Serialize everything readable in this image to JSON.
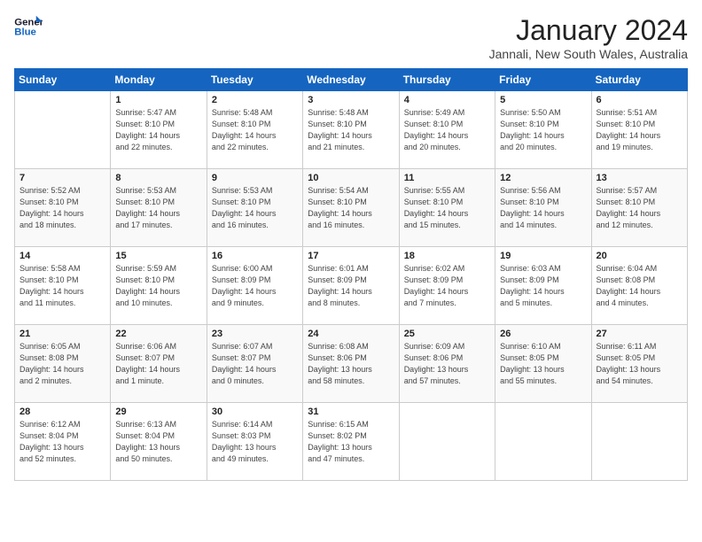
{
  "header": {
    "logo_line1": "General",
    "logo_line2": "Blue",
    "month_title": "January 2024",
    "location": "Jannali, New South Wales, Australia"
  },
  "weekdays": [
    "Sunday",
    "Monday",
    "Tuesday",
    "Wednesday",
    "Thursday",
    "Friday",
    "Saturday"
  ],
  "weeks": [
    [
      {
        "day": "",
        "info": ""
      },
      {
        "day": "1",
        "info": "Sunrise: 5:47 AM\nSunset: 8:10 PM\nDaylight: 14 hours\nand 22 minutes."
      },
      {
        "day": "2",
        "info": "Sunrise: 5:48 AM\nSunset: 8:10 PM\nDaylight: 14 hours\nand 22 minutes."
      },
      {
        "day": "3",
        "info": "Sunrise: 5:48 AM\nSunset: 8:10 PM\nDaylight: 14 hours\nand 21 minutes."
      },
      {
        "day": "4",
        "info": "Sunrise: 5:49 AM\nSunset: 8:10 PM\nDaylight: 14 hours\nand 20 minutes."
      },
      {
        "day": "5",
        "info": "Sunrise: 5:50 AM\nSunset: 8:10 PM\nDaylight: 14 hours\nand 20 minutes."
      },
      {
        "day": "6",
        "info": "Sunrise: 5:51 AM\nSunset: 8:10 PM\nDaylight: 14 hours\nand 19 minutes."
      }
    ],
    [
      {
        "day": "7",
        "info": "Sunrise: 5:52 AM\nSunset: 8:10 PM\nDaylight: 14 hours\nand 18 minutes."
      },
      {
        "day": "8",
        "info": "Sunrise: 5:53 AM\nSunset: 8:10 PM\nDaylight: 14 hours\nand 17 minutes."
      },
      {
        "day": "9",
        "info": "Sunrise: 5:53 AM\nSunset: 8:10 PM\nDaylight: 14 hours\nand 16 minutes."
      },
      {
        "day": "10",
        "info": "Sunrise: 5:54 AM\nSunset: 8:10 PM\nDaylight: 14 hours\nand 16 minutes."
      },
      {
        "day": "11",
        "info": "Sunrise: 5:55 AM\nSunset: 8:10 PM\nDaylight: 14 hours\nand 15 minutes."
      },
      {
        "day": "12",
        "info": "Sunrise: 5:56 AM\nSunset: 8:10 PM\nDaylight: 14 hours\nand 14 minutes."
      },
      {
        "day": "13",
        "info": "Sunrise: 5:57 AM\nSunset: 8:10 PM\nDaylight: 14 hours\nand 12 minutes."
      }
    ],
    [
      {
        "day": "14",
        "info": "Sunrise: 5:58 AM\nSunset: 8:10 PM\nDaylight: 14 hours\nand 11 minutes."
      },
      {
        "day": "15",
        "info": "Sunrise: 5:59 AM\nSunset: 8:10 PM\nDaylight: 14 hours\nand 10 minutes."
      },
      {
        "day": "16",
        "info": "Sunrise: 6:00 AM\nSunset: 8:09 PM\nDaylight: 14 hours\nand 9 minutes."
      },
      {
        "day": "17",
        "info": "Sunrise: 6:01 AM\nSunset: 8:09 PM\nDaylight: 14 hours\nand 8 minutes."
      },
      {
        "day": "18",
        "info": "Sunrise: 6:02 AM\nSunset: 8:09 PM\nDaylight: 14 hours\nand 7 minutes."
      },
      {
        "day": "19",
        "info": "Sunrise: 6:03 AM\nSunset: 8:09 PM\nDaylight: 14 hours\nand 5 minutes."
      },
      {
        "day": "20",
        "info": "Sunrise: 6:04 AM\nSunset: 8:08 PM\nDaylight: 14 hours\nand 4 minutes."
      }
    ],
    [
      {
        "day": "21",
        "info": "Sunrise: 6:05 AM\nSunset: 8:08 PM\nDaylight: 14 hours\nand 2 minutes."
      },
      {
        "day": "22",
        "info": "Sunrise: 6:06 AM\nSunset: 8:07 PM\nDaylight: 14 hours\nand 1 minute."
      },
      {
        "day": "23",
        "info": "Sunrise: 6:07 AM\nSunset: 8:07 PM\nDaylight: 14 hours\nand 0 minutes."
      },
      {
        "day": "24",
        "info": "Sunrise: 6:08 AM\nSunset: 8:06 PM\nDaylight: 13 hours\nand 58 minutes."
      },
      {
        "day": "25",
        "info": "Sunrise: 6:09 AM\nSunset: 8:06 PM\nDaylight: 13 hours\nand 57 minutes."
      },
      {
        "day": "26",
        "info": "Sunrise: 6:10 AM\nSunset: 8:05 PM\nDaylight: 13 hours\nand 55 minutes."
      },
      {
        "day": "27",
        "info": "Sunrise: 6:11 AM\nSunset: 8:05 PM\nDaylight: 13 hours\nand 54 minutes."
      }
    ],
    [
      {
        "day": "28",
        "info": "Sunrise: 6:12 AM\nSunset: 8:04 PM\nDaylight: 13 hours\nand 52 minutes."
      },
      {
        "day": "29",
        "info": "Sunrise: 6:13 AM\nSunset: 8:04 PM\nDaylight: 13 hours\nand 50 minutes."
      },
      {
        "day": "30",
        "info": "Sunrise: 6:14 AM\nSunset: 8:03 PM\nDaylight: 13 hours\nand 49 minutes."
      },
      {
        "day": "31",
        "info": "Sunrise: 6:15 AM\nSunset: 8:02 PM\nDaylight: 13 hours\nand 47 minutes."
      },
      {
        "day": "",
        "info": ""
      },
      {
        "day": "",
        "info": ""
      },
      {
        "day": "",
        "info": ""
      }
    ]
  ]
}
